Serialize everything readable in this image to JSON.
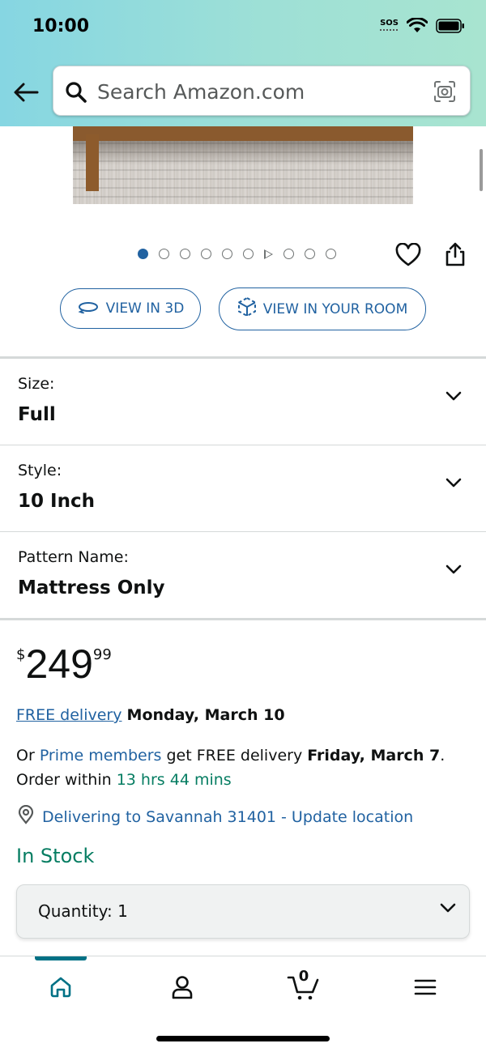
{
  "status_bar": {
    "time": "10:00",
    "sos": "SOS"
  },
  "header": {
    "search_placeholder": "Search Amazon.com"
  },
  "gallery": {
    "dot_count": 10,
    "active_index": 0,
    "video_index": 6
  },
  "view_buttons": {
    "view_3d": "VIEW IN 3D",
    "view_room": "VIEW IN YOUR ROOM"
  },
  "selectors": [
    {
      "label": "Size:",
      "value": "Full"
    },
    {
      "label": "Style:",
      "value": "10 Inch"
    },
    {
      "label": "Pattern Name:",
      "value": "Mattress Only"
    }
  ],
  "price": {
    "symbol": "$",
    "whole": "249",
    "fraction": "99"
  },
  "delivery": {
    "free_delivery_link": "FREE delivery",
    "date": "Monday, March 10"
  },
  "prime": {
    "prefix": "Or ",
    "prime_link": "Prime members",
    "middle": " get FREE delivery ",
    "date": "Friday, March 7",
    "suffix": ".",
    "order_prefix": "Order within ",
    "countdown": "13 hrs 44 mins"
  },
  "location": {
    "text": "Delivering to Savannah 31401 - Update location"
  },
  "stock": {
    "status": "In Stock"
  },
  "quantity": {
    "label": "Quantity:",
    "value": "1"
  },
  "bottom_nav": {
    "cart_count": "0"
  },
  "colors": {
    "link": "#2162a1",
    "green": "#067d62",
    "nav_active": "#007185"
  }
}
